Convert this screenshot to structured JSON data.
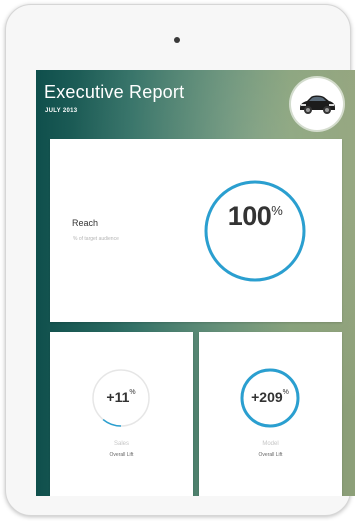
{
  "report": {
    "title": "Executive Report",
    "period": "JULY 2013"
  },
  "avatar": {
    "icon": "car-icon"
  },
  "reach": {
    "label": "Reach",
    "sublabel": "% of target audience",
    "value": "100",
    "unit": "%",
    "progress": 1.0
  },
  "sales": {
    "value": "+11",
    "unit": "%",
    "label": "Sales",
    "sublabel": "Overall Lift",
    "progress": 0.11
  },
  "model": {
    "value": "+209",
    "unit": "%",
    "label": "Model",
    "sublabel": "Overall Lift",
    "progress": 1.0
  },
  "colors": {
    "accent": "#2a9fd0",
    "track": "#e6e6e6",
    "header_gradient_start": "#0f4f4c",
    "header_gradient_end": "#8d9f78"
  }
}
